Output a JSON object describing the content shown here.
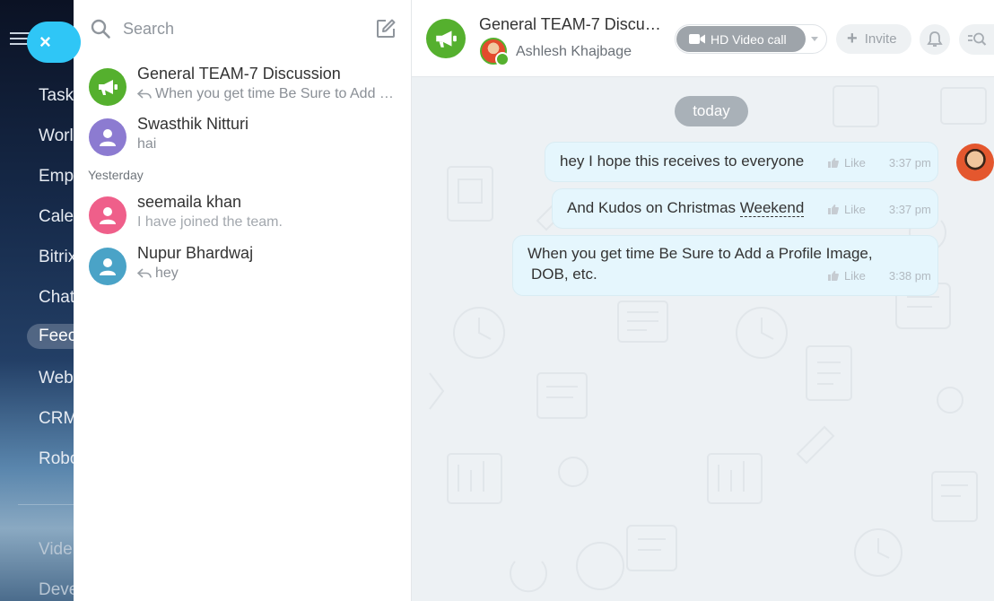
{
  "nav": {
    "items": [
      "Task",
      "Worl",
      "Emp",
      "Cale",
      "Bitrix",
      "Chat",
      "Feec",
      "Web",
      "CRM",
      "Robo",
      "Vide",
      "Deve"
    ],
    "close_label": "×"
  },
  "list": {
    "search_placeholder": "Search",
    "section_yesterday": "Yesterday",
    "chats": [
      {
        "name": "General TEAM-7 Discussion",
        "preview": "When you get time Be Sure to Add a Profile Image, DOB, etc.",
        "reply": true,
        "color": "#55b02e",
        "icon": "megaphone-icon"
      },
      {
        "name": "Swasthik Nitturi",
        "preview": "hai",
        "reply": false,
        "color": "#8c7bd1",
        "icon": "user-icon"
      },
      {
        "name": "seemaila khan",
        "preview": "I have joined the team.",
        "reply": false,
        "color": "#ef5f8a",
        "icon": "user-icon"
      },
      {
        "name": "Nupur Bhardwaj",
        "preview": "hey",
        "reply": true,
        "color": "#4aa3c7",
        "icon": "user-icon"
      }
    ]
  },
  "header": {
    "title": "General TEAM-7 Discussion",
    "member_name": "Ashlesh Khajbage",
    "video_call_label": "HD Video call",
    "invite_label": "Invite"
  },
  "messages": {
    "date_label": "today",
    "items": [
      {
        "text": "hey I hope this receives to everyone",
        "like": "Like",
        "time": "3:37 pm"
      },
      {
        "text_before": "And Kudos on Christmas ",
        "text_underlined": "Weekend",
        "like": "Like",
        "time": "3:37 pm"
      },
      {
        "line1": "When you get time Be Sure to Add a Profile Image,",
        "line2": "DOB, etc.",
        "like": "Like",
        "time": "3:38 pm"
      }
    ]
  },
  "colors": {
    "accent": "#2fc6f6",
    "group": "#55b02e",
    "bubble": "#e5f6fd",
    "chat_bg": "#edf1f4"
  }
}
